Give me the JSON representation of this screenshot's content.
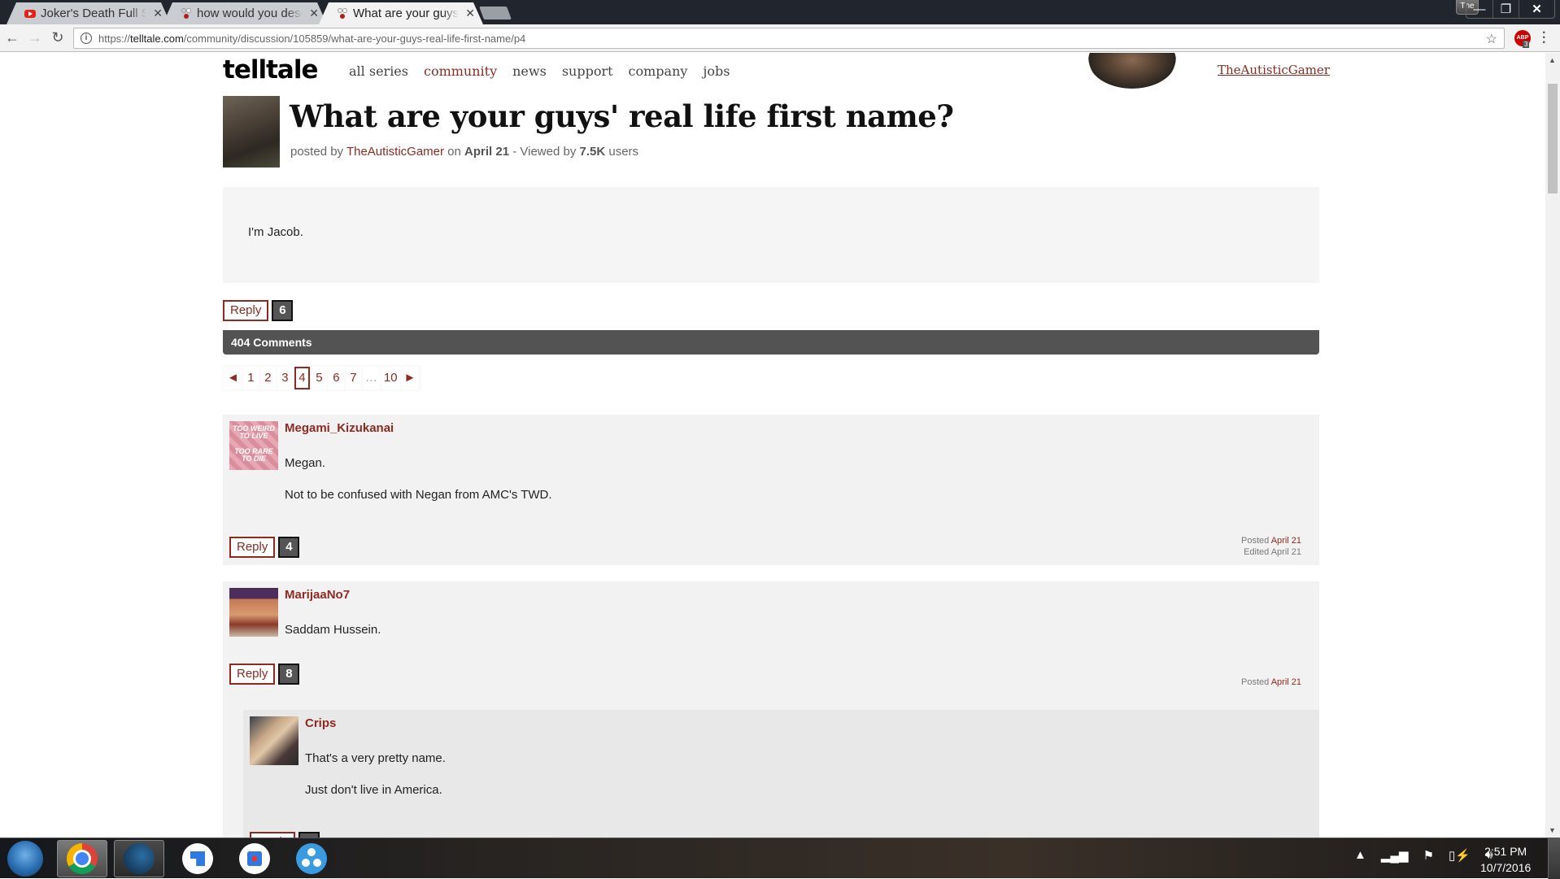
{
  "browser": {
    "tabs": [
      {
        "label": "Joker's Death Full Scene",
        "icon": "youtube-icon",
        "active": false
      },
      {
        "label": "how would you describe",
        "icon": "telltale-icon",
        "active": false
      },
      {
        "label": "What are your guys' real",
        "icon": "telltale-icon",
        "active": true
      }
    ],
    "profile_label": "The",
    "url_prefix": "https://",
    "url_host": "telltale.com",
    "url_path": "/community/discussion/105859/what-are-your-guys-real-life-first-name/p4",
    "extension_badge": "3",
    "extension_label": "ABP"
  },
  "site": {
    "logo": "telltale",
    "nav": [
      {
        "label": "all series",
        "active": false
      },
      {
        "label": "community",
        "active": true
      },
      {
        "label": "news",
        "active": false
      },
      {
        "label": "support",
        "active": false
      },
      {
        "label": "company",
        "active": false
      },
      {
        "label": "jobs",
        "active": false
      }
    ],
    "current_user": "TheAutisticGamer"
  },
  "discussion": {
    "title": "What are your guys' real life first name?",
    "posted_by_prefix": "posted by",
    "author": "TheAutisticGamer",
    "on_label": "on",
    "date": "April 21",
    "viewed_prefix": "- Viewed by",
    "views": "7.5K",
    "views_suffix": "users",
    "body": "I'm Jacob.",
    "reply_label": "Reply",
    "reply_count": "6",
    "comments_count_label": "404 Comments"
  },
  "pagination": {
    "prev": "◄",
    "pages": [
      "1",
      "2",
      "3",
      "4",
      "5",
      "6",
      "7",
      "…",
      "10"
    ],
    "current": "4",
    "next": "►"
  },
  "comments": [
    {
      "author": "Megami_Kizukanai",
      "avatar_text": [
        "TOO WEIRD",
        "TO LIVE",
        "TOO RARE",
        "TO DIE"
      ],
      "paragraphs": [
        "Megan.",
        "Not to be confused with Negan from AMC's TWD."
      ],
      "reply_label": "Reply",
      "reply_count": "4",
      "posted_label": "Posted",
      "posted_date": "April 21",
      "edited_label": "Edited April 21"
    },
    {
      "author": "MarijaaNo7",
      "paragraphs": [
        "Saddam Hussein."
      ],
      "reply_label": "Reply",
      "reply_count": "8",
      "posted_label": "Posted",
      "posted_date": "April 21",
      "replies": [
        {
          "author": "Crips",
          "paragraphs": [
            "That's a very pretty name.",
            "Just don't live in America."
          ],
          "reply_label": "Reply"
        }
      ]
    }
  ],
  "taskbar": {
    "apps": [
      "windows-start",
      "chrome",
      "steam",
      "app-blue-arrow",
      "app-blue-target",
      "app-blue-dots"
    ],
    "time": "2:51 PM",
    "date": "10/7/2016"
  }
}
